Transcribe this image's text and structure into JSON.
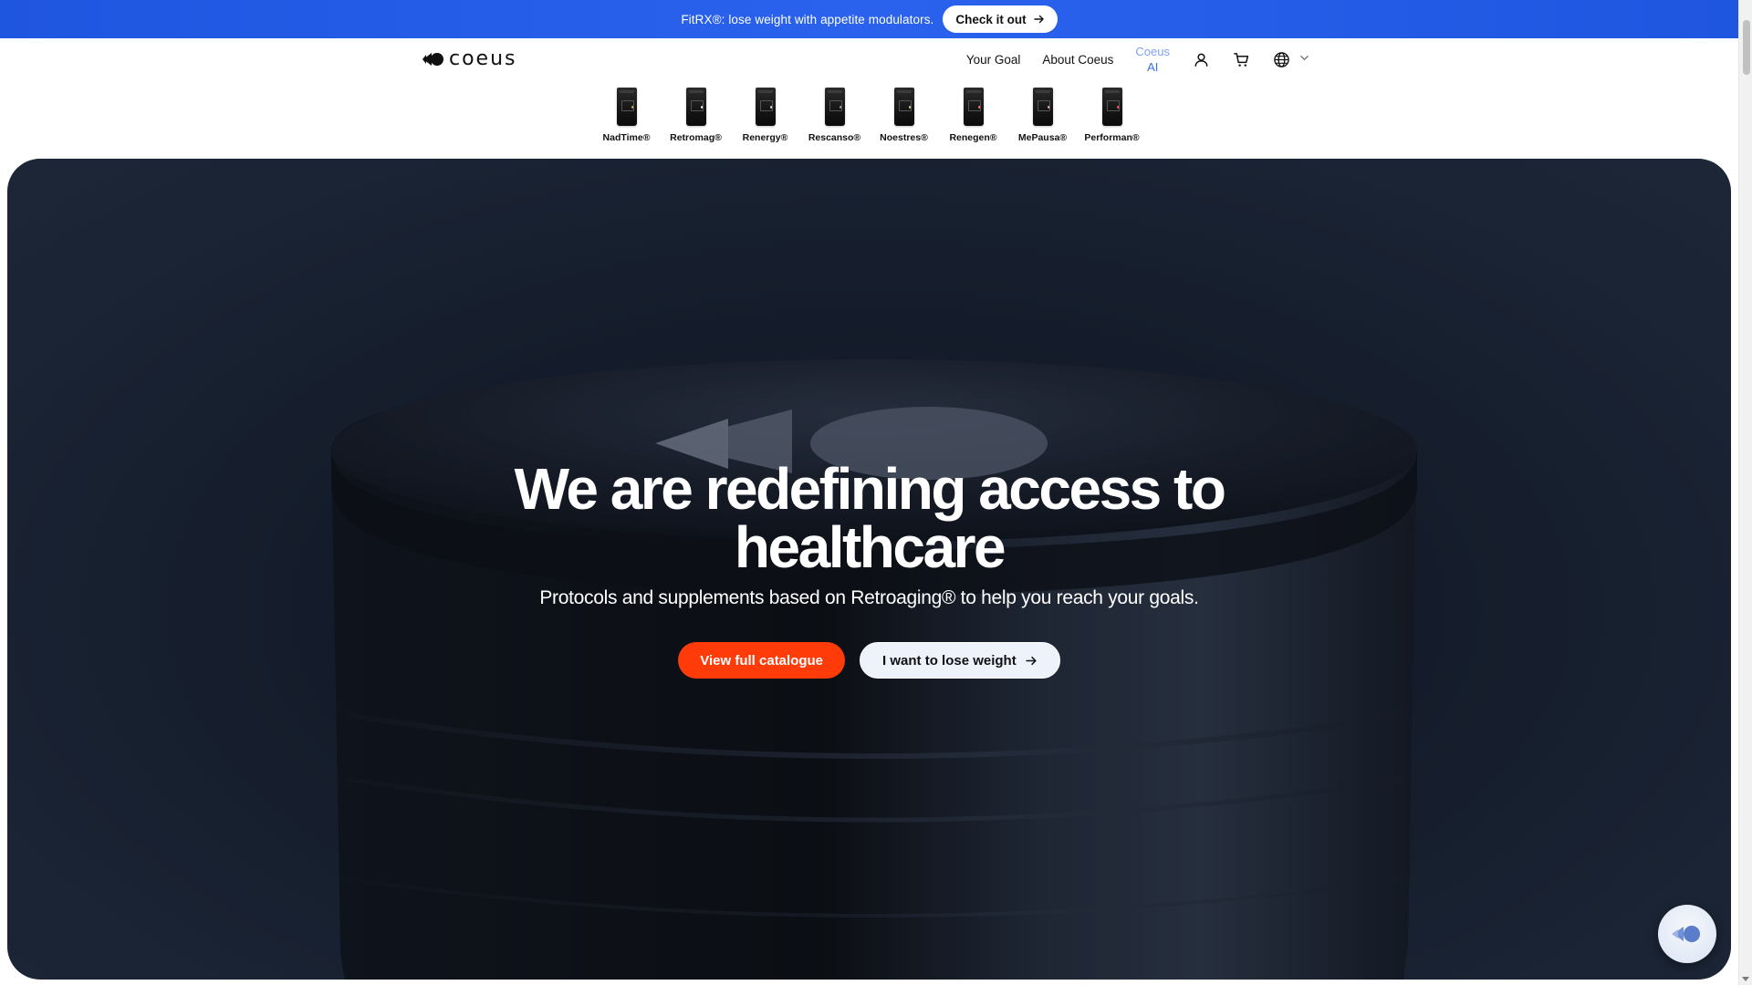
{
  "promo": {
    "text": "FitRX®: lose weight with appetite modulators.",
    "button_label": "Check it out"
  },
  "header": {
    "logo_text": "coeus",
    "nav": {
      "your_goal": "Your Goal",
      "about": "About Coeus",
      "ai_top": "Coeus",
      "ai_bottom": "AI"
    },
    "icons": [
      "user-icon",
      "cart-icon",
      "globe-icon",
      "chevron-down-icon"
    ]
  },
  "products": [
    {
      "label": "NadTime®",
      "accent": "#c9a35a"
    },
    {
      "label": "Retromag®",
      "accent": "#e6e6e6"
    },
    {
      "label": "Renergy®",
      "accent": "#cfcfcf"
    },
    {
      "label": "Rescanso®",
      "accent": "#9b9b9b"
    },
    {
      "label": "Noestres®",
      "accent": "#d7c38f"
    },
    {
      "label": "Renegen®",
      "accent": "#ff6b6b"
    },
    {
      "label": "MePausa®",
      "accent": "#e8a3b8"
    },
    {
      "label": "Performan®",
      "accent": "#ff4d6d"
    }
  ],
  "hero": {
    "title": "We are redefining access to healthcare",
    "subtitle": "Protocols and supplements based on Retroaging® to help you reach your goals.",
    "primary_button": "View full catalogue",
    "secondary_button": "I want to lose weight"
  },
  "colors": {
    "promo_bg": "#2a62ee",
    "primary_button": "#ff3b0a",
    "ai_link": "#3a6fe8",
    "hero_bg": "#121a28"
  }
}
